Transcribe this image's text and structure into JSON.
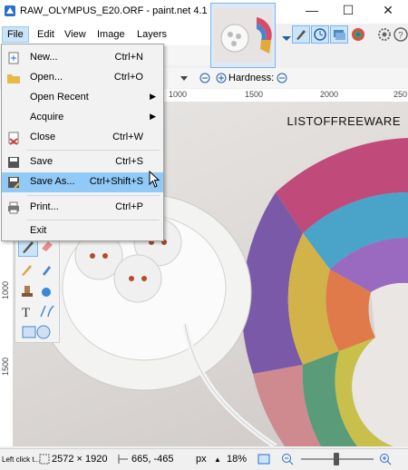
{
  "window": {
    "title": "RAW_OLYMPUS_E20.ORF - paint.net 4.1",
    "minimize": "—",
    "maximize": "☐",
    "close": "✕"
  },
  "menubar": {
    "items": [
      "File",
      "Edit",
      "View",
      "Image",
      "Layers"
    ]
  },
  "toolbar": {
    "hardness_label": "Hardness:"
  },
  "ruler": {
    "labels": [
      "1000",
      "1500",
      "2000",
      "250"
    ]
  },
  "vruler": {
    "labels": [
      "1000",
      "1500"
    ]
  },
  "watermark": "LISTOFFREEWARE",
  "file_menu": {
    "items": [
      {
        "label": "New...",
        "shortcut": "Ctrl+N",
        "icon": "new-file-icon"
      },
      {
        "label": "Open...",
        "shortcut": "Ctrl+O",
        "icon": "open-folder-icon"
      },
      {
        "label": "Open Recent",
        "shortcut": "",
        "icon": "",
        "submenu": true
      },
      {
        "label": "Acquire",
        "shortcut": "",
        "icon": "",
        "submenu": true
      },
      {
        "label": "Close",
        "shortcut": "Ctrl+W",
        "icon": "close-document-icon"
      },
      {
        "label": "Save",
        "shortcut": "Ctrl+S",
        "icon": "save-icon"
      },
      {
        "label": "Save As...",
        "shortcut": "Ctrl+Shift+S",
        "icon": "save-as-icon",
        "highlighted": true
      },
      {
        "label": "Print...",
        "shortcut": "Ctrl+P",
        "icon": "print-icon"
      },
      {
        "label": "Exit",
        "shortcut": "",
        "icon": ""
      }
    ]
  },
  "statusbar": {
    "hint": "Left click t...",
    "image_size": "2572 × 1920",
    "cursor_pos": "665, -465",
    "units": "px",
    "zoom": "18%"
  },
  "colors": {
    "accent": "#0078d7",
    "menu_highlight": "#91c9f7"
  }
}
